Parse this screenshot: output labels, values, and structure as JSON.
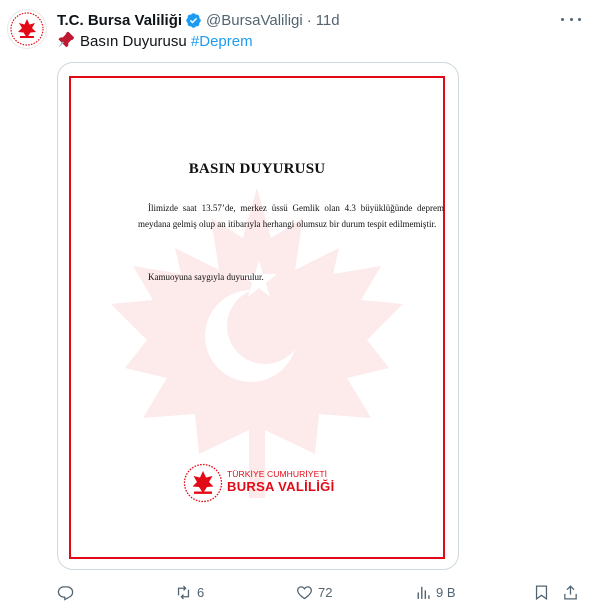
{
  "tweet": {
    "display_name": "T.C. Bursa Valiliği",
    "handle": "@BursaValiligi",
    "separator": "·",
    "time": "11d",
    "text_prefix": "Basın Duyurusu",
    "hashtag": "#Deprem",
    "icons": {
      "avatar": "bursa-valiligi-emblem",
      "verified": "verified-badge-icon",
      "more": "more-options-icon",
      "pin": "pushpin-icon"
    }
  },
  "document": {
    "title": "BASIN DUYURUSU",
    "body": "İlimizde saat 13.57’de, merkez üssü Gemlik olan 4.3 büyüklüğünde deprem meydana gelmiş olup an itibarıyla herhangi olumsuz bir durum tespit edilmemiştir.",
    "closing": "Kamuoyuna saygıyla duyurulur.",
    "org_line1": "TÜRKİYE CUMHURİYETİ",
    "org_line2": "BURSA VALİLİĞİ",
    "watermark": "maple-leaf-crescent-star-emblem"
  },
  "actions": {
    "reply_count": "",
    "retweet_count": "6",
    "like_count": "72",
    "views_count": "9 B"
  },
  "colors": {
    "accent": "#1d9bf0",
    "brand_red": "#e30a17",
    "muted": "#536471",
    "border": "#cfd9de"
  }
}
